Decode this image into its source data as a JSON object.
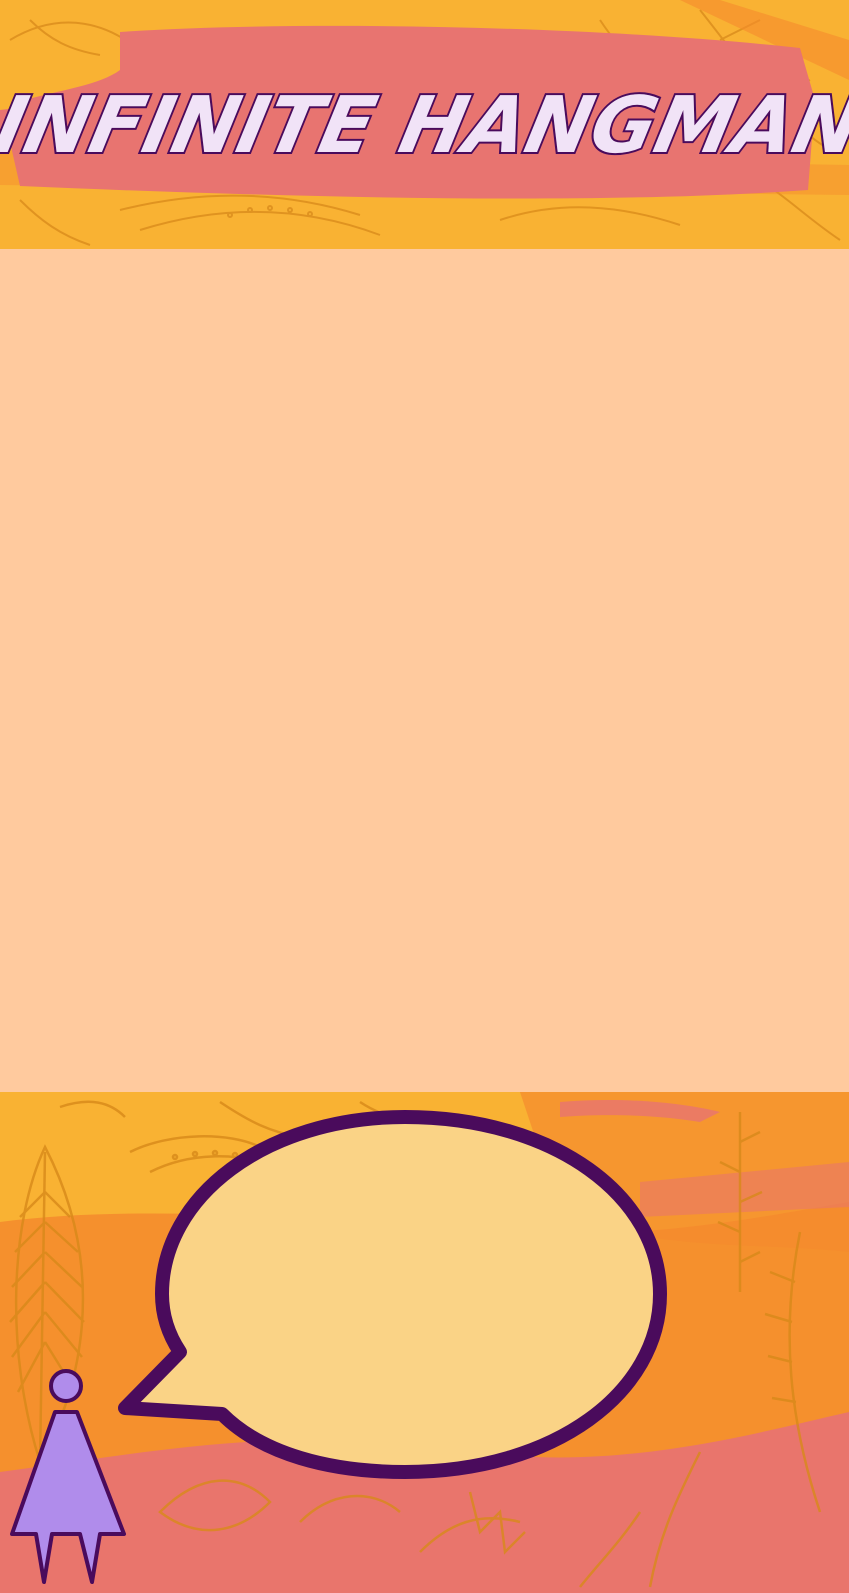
{
  "app": {
    "title": "INFINITE HANGMAN"
  },
  "speech_bubble": {
    "text": ""
  },
  "colors": {
    "background_orange": "#F9B233",
    "accent_orange": "#F58A2D",
    "banner_pink": "#E87470",
    "play_area": "#FFCA9E",
    "bubble_fill": "#FAD386",
    "outline_purple": "#4A0B5C",
    "figure_fill": "#B08CEB",
    "foliage": "#D8891A"
  },
  "icons": {
    "player": "person-figure-icon",
    "speech": "speech-bubble-icon"
  }
}
